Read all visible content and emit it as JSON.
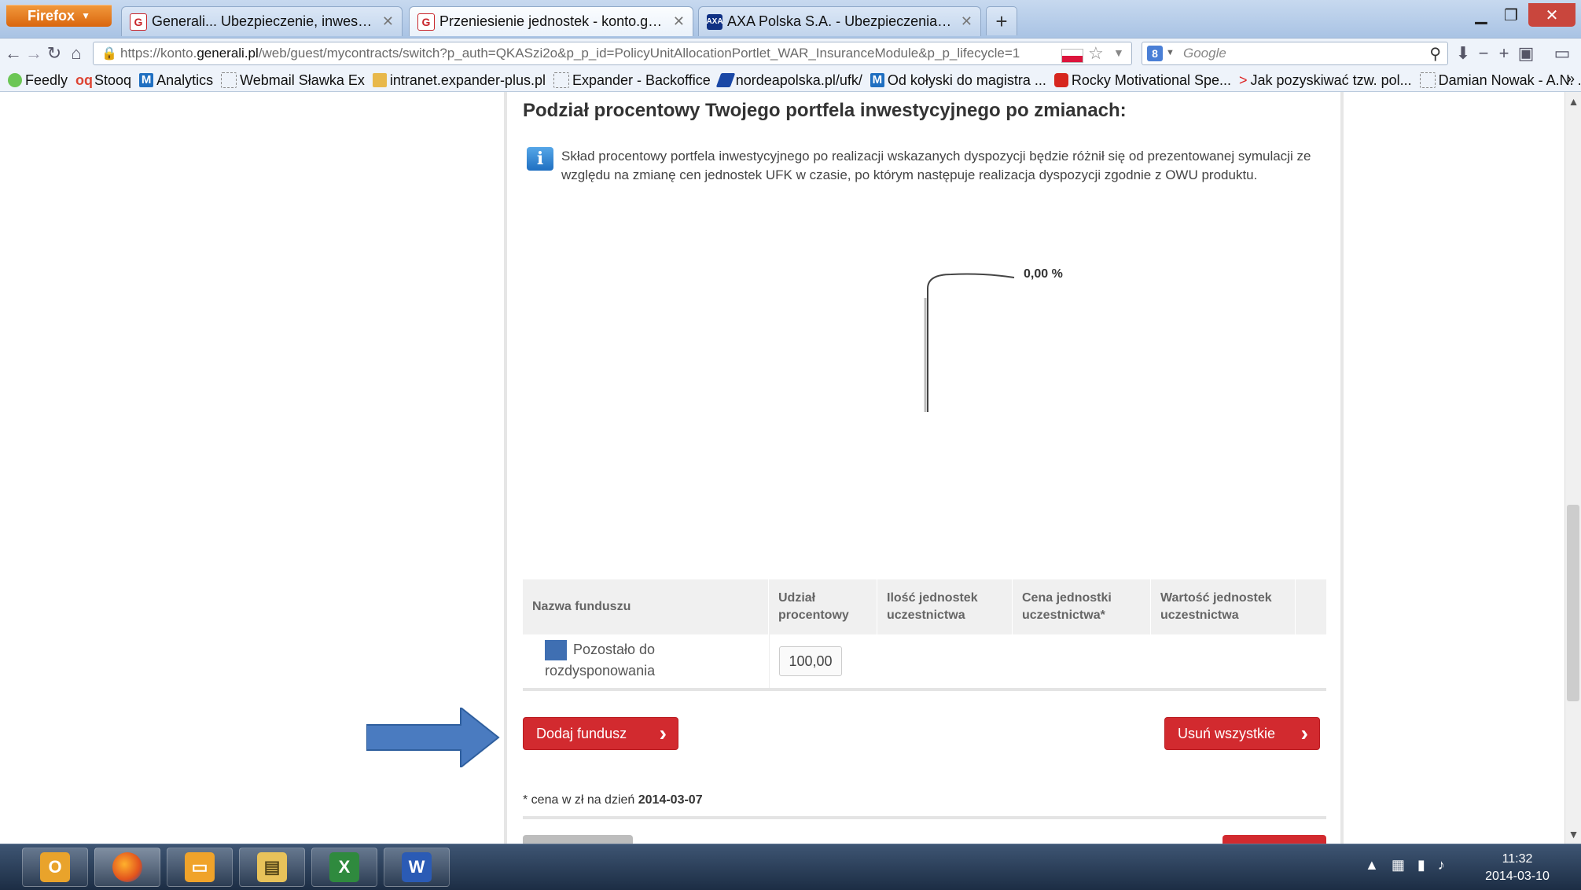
{
  "browser": {
    "menu_label": "Firefox",
    "tabs": [
      {
        "title": "Generali... Ubezpieczenie, inwestycje, ...",
        "favicon": "generali-icon",
        "active": false
      },
      {
        "title": "Przeniesienie jednostek - konto.gener...",
        "favicon": "generali-icon",
        "active": true
      },
      {
        "title": "AXA Polska S.A. - Ubezpieczenia, Eme...",
        "favicon": "axa-icon",
        "active": false
      }
    ],
    "new_tab": "+",
    "url_prefix": "https://konto.",
    "url_domain": "generali.pl",
    "url_rest": "/web/guest/mycontracts/switch?p_auth=QKASzi2o&p_p_id=PolicyUnitAllocationPortlet_WAR_InsuranceModule&p_p_lifecycle=1",
    "search_placeholder": "Google",
    "bookmarks": [
      "Feedly",
      "Stooq",
      "Analytics",
      "Webmail Sławka Ex",
      "intranet.expander-plus.pl",
      "Expander - Backoffice",
      "nordeapolska.pl/ufk/",
      "Od kołyski do magistra ...",
      "Rocky Motivational Spe...",
      "Jak pozyskiwać tzw. pol...",
      "Damian Nowak - A.N. ..."
    ],
    "bookmarks_overflow": "»"
  },
  "page": {
    "section_title": "Podział procentowy Twojego portfela inwestycyjnego po zmianach:",
    "info_text": "Skład procentowy portfela inwestycyjnego po realizacji wskazanych dyspozycji będzie różnił się od prezentowanej symulacji ze względu na zmianę cen jednostek UFK w czasie, po którym następuje realizacja dyspozycji zgodnie z OWU produktu.",
    "pie_label": "0,00 %",
    "table": {
      "headers": [
        "Nazwa funduszu",
        "Udział procentowy",
        "Ilość jednostek uczestnictwa",
        "Cena jednostki uczestnictwa*",
        "Wartość jednostek uczestnictwa"
      ],
      "row": {
        "fund_name": "Pozostało do rozdysponowania",
        "share_value": "100,00",
        "swatch_color": "#3f6fb2"
      }
    },
    "add_fund_button": "Dodaj fundusz",
    "remove_all_button": "Usuń wszystkie",
    "price_note_prefix": "* cena w zł na dzień ",
    "price_note_date": "2014-03-07"
  },
  "taskbar": {
    "apps": [
      "outlook-icon",
      "firefox-icon",
      "slides-icon",
      "explorer-icon",
      "excel-icon",
      "word-icon"
    ],
    "time": "11:32",
    "date": "2014-03-10"
  }
}
